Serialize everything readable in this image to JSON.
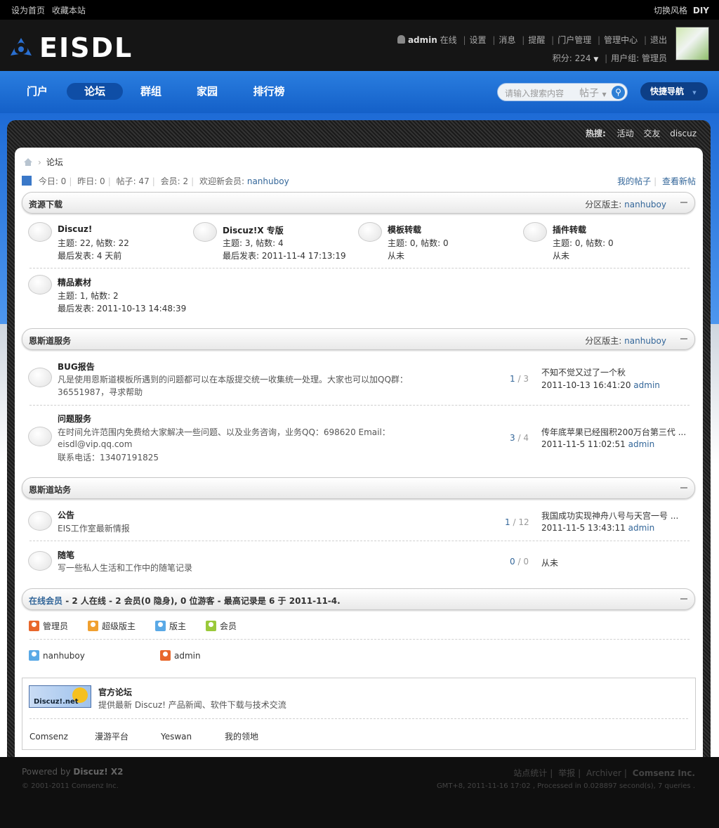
{
  "topbar": {
    "set_home": "设为首页",
    "bookmark": "收藏本站",
    "switch_style": "切换风格",
    "diy": "DIY"
  },
  "header": {
    "logo": "EISDL",
    "user": "admin",
    "online": "在线",
    "links": [
      "设置",
      "消息",
      "提醒",
      "门户管理",
      "管理中心",
      "退出"
    ],
    "points": "积分: 224",
    "group": "用户组: 管理员"
  },
  "nav": {
    "items": [
      "门户",
      "论坛",
      "群组",
      "家园",
      "排行榜"
    ],
    "active": "论坛",
    "search_placeholder": "请输入搜索内容",
    "search_type": "帖子",
    "quick_nav": "快捷导航"
  },
  "hot": {
    "label": "热搜:",
    "items": [
      "活动",
      "交友",
      "discuz"
    ]
  },
  "breadcrumb": {
    "current": "论坛"
  },
  "stats": {
    "today": "今日: 0",
    "yesterday": "昨日: 0",
    "posts": "帖子: 47",
    "members": "会员: 2",
    "welcome": "欢迎新会员:",
    "new_member": "nanhuboy",
    "my_posts": "我的帖子",
    "new_posts": "查看新帖"
  },
  "sections": [
    {
      "title": "资源下载",
      "moderator_label": "分区版主:",
      "moderator": "nanhuboy",
      "forums": [
        {
          "name": "Discuz!",
          "stats": "主题: 22, 帖数: 22",
          "last": "最后发表: 4 天前"
        },
        {
          "name": "Discuz!X 专版",
          "stats": "主题: 3, 帖数: 4",
          "last": "最后发表: 2011-11-4 17:13:19"
        },
        {
          "name": "模板转载",
          "stats": "主题: 0, 帖数: 0",
          "last": "从未"
        },
        {
          "name": "插件转载",
          "stats": "主题: 0, 帖数: 0",
          "last": "从未"
        },
        {
          "name": "精品素材",
          "stats": "主题: 1, 帖数: 2",
          "last": "最后发表: 2011-10-13 14:48:39"
        }
      ]
    },
    {
      "title": "恩斯道服务",
      "moderator_label": "分区版主:",
      "moderator": "nanhuboy",
      "forums": [
        {
          "name": "BUG报告",
          "desc1": "凡是使用恩斯道模板所遇到的问题都可以在本版提交统一收集统一处理。大家也可以加QQ群：",
          "desc2": "36551987，寻求帮助",
          "threads": "1",
          "posts": "3",
          "last_title": "不知不觉又过了一个秋",
          "last_time": "2011-10-13 16:41:20",
          "last_user": "admin"
        },
        {
          "name": "问题服务",
          "desc1": "在时间允许范围内免费给大家解决一些问题、以及业务咨询，业务QQ：698620 Email：",
          "desc2": "eisdl@vip.qq.com",
          "desc3": "联系电话：13407191825",
          "threads": "3",
          "posts": "4",
          "last_title": "传年底苹果已经囤积200万台第三代 ...",
          "last_time": "2011-11-5 11:02:51",
          "last_user": "admin"
        }
      ]
    },
    {
      "title": "恩斯道站务",
      "forums": [
        {
          "name": "公告",
          "desc1": "EIS工作室最新情报",
          "threads": "1",
          "posts": "12",
          "last_title": "我国成功实现神舟八号与天宫一号 ...",
          "last_time": "2011-11-5 13:43:11",
          "last_user": "admin"
        },
        {
          "name": "随笔",
          "desc1": "写一些私人生活和工作中的随笔记录",
          "threads": "0",
          "posts": "0",
          "last_title": "从未"
        }
      ]
    }
  ],
  "online": {
    "link": "在线会员",
    "summary": " - 2 人在线 - 2 会员(0 隐身), 0 位游客 - 最高记录是 6 于 2011-11-4.",
    "legend": [
      "管理员",
      "超级版主",
      "版主",
      "会员"
    ],
    "members": [
      "nanhuboy",
      "admin"
    ]
  },
  "links": {
    "logo_text": "Discuz!.net",
    "title": "官方论坛",
    "desc": "提供最新 Discuz! 产品新闻、软件下载与技术交流",
    "items": [
      "Comsenz",
      "漫游平台",
      "Yeswan",
      "我的领地"
    ]
  },
  "footer": {
    "powered": "Powered by",
    "product": "Discuz! X2",
    "copyright": "© 2001-2011",
    "company": "Comsenz Inc.",
    "links": [
      "站点统计",
      "举报",
      "Archiver",
      "Comsenz Inc."
    ],
    "debug": "GMT+8, 2011-11-16 17:02 , Processed in 0.028897 second(s), 7 queries ."
  },
  "colors": {
    "nav_blue": "#1e6bd6",
    "link": "#336699",
    "admin_icon": "#e8672c",
    "super_mod_icon": "#f0a030",
    "mod_icon": "#5aa9e6",
    "member_icon": "#9ac93a"
  }
}
